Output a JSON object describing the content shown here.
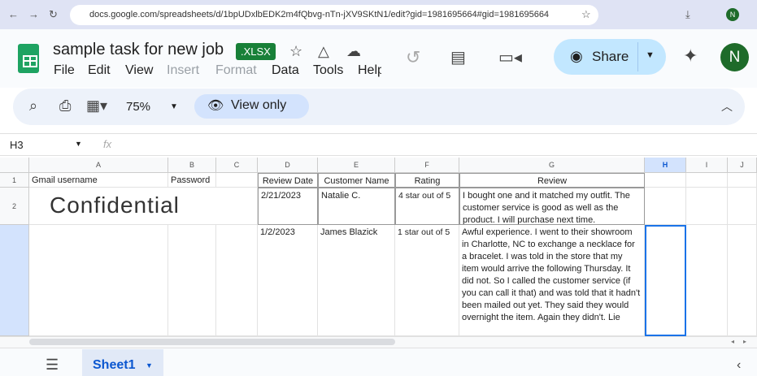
{
  "browser": {
    "url": "docs.google.com/spreadsheets/d/1bpUDxlbEDK2m4fQbvg-nTn-jXV9SKtN1/edit?gid=1981695664#gid=1981695664",
    "avatar": "N"
  },
  "doc": {
    "title": "sample task for new job",
    "badge": ".XLSX",
    "share": "Share",
    "avatar": "N"
  },
  "menu": [
    "File",
    "Edit",
    "View",
    "Insert",
    "Format",
    "Data",
    "Tools",
    "Help"
  ],
  "toolbar": {
    "zoom": "75%",
    "mode": "View only"
  },
  "namebox": {
    "cell": "H3",
    "fx": "fx"
  },
  "columns": [
    "A",
    "B",
    "C",
    "D",
    "E",
    "F",
    "G",
    "H",
    "I",
    "J"
  ],
  "rows": [
    "1",
    "2"
  ],
  "cells": {
    "A1": "Gmail username",
    "B1": "Password",
    "D1": "Review Date",
    "E1": "Customer Name",
    "F1": "Rating",
    "G1": "Review",
    "A2": "Confidential",
    "D2": "2/21/2023",
    "E2": "Natalie C.",
    "F2": "4 star out of 5",
    "G2": "I bought one and it matched my outfit. The customer service is good as well as the product. I will purchase next time.",
    "D3": "1/2/2023",
    "E3": "James Blazick",
    "F3": "1 star out of 5",
    "G3": "Awful experience. I went to their showroom in Charlotte, NC to exchange a necklace for a bracelet. I was told in the store that my item would arrive the following Thursday. It did not. So I called the customer service (if you can call it that) and was told that it hadn't been mailed out yet. They said they would overnight the item. Again they didn't. Lie"
  },
  "sheet": {
    "tab": "Sheet1"
  }
}
